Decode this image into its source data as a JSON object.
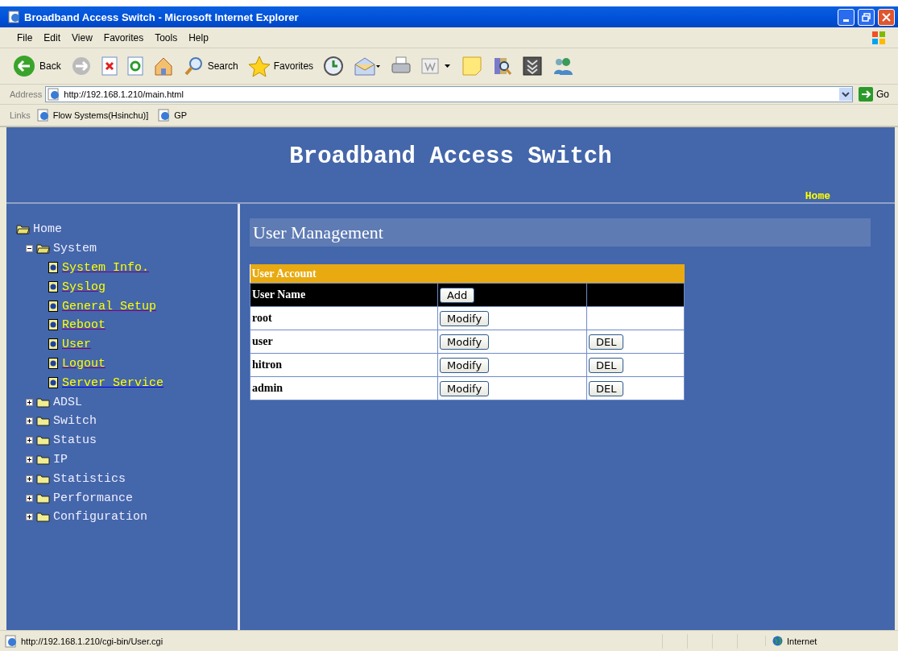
{
  "window": {
    "title": "Broadband Access Switch - Microsoft Internet Explorer"
  },
  "menu": [
    "File",
    "Edit",
    "View",
    "Favorites",
    "Tools",
    "Help"
  ],
  "toolbar": [
    {
      "kind": "back",
      "label": "Back"
    },
    {
      "kind": "forward"
    },
    {
      "kind": "stop"
    },
    {
      "kind": "refresh"
    },
    {
      "kind": "home"
    },
    {
      "kind": "search",
      "label": "Search"
    },
    {
      "kind": "favorites",
      "label": "Favorites"
    },
    {
      "kind": "history"
    },
    {
      "kind": "mail"
    },
    {
      "kind": "print"
    },
    {
      "kind": "edit"
    },
    {
      "kind": "note"
    },
    {
      "kind": "research"
    },
    {
      "kind": "download"
    },
    {
      "kind": "messenger"
    }
  ],
  "address": {
    "label": "Address",
    "value": "http://192.168.1.210/main.html",
    "go": "Go"
  },
  "links": {
    "label": "Links",
    "items": [
      "Flow Systems(Hsinchu)]",
      "GP"
    ]
  },
  "page": {
    "title": "Broadband Access Switch",
    "home_link": "Home"
  },
  "tree": {
    "label": "Home",
    "expanded": true,
    "children": [
      {
        "label": "System",
        "expanded": true,
        "children": [
          {
            "label": "System Info.",
            "kind": "page",
            "visited": true
          },
          {
            "label": "Syslog",
            "kind": "page",
            "visited": true
          },
          {
            "label": "General Setup",
            "kind": "page",
            "visited": true
          },
          {
            "label": "Reboot",
            "kind": "page",
            "visited": true
          },
          {
            "label": "User",
            "kind": "page",
            "visited": true
          },
          {
            "label": "Logout",
            "kind": "page",
            "visited": true
          },
          {
            "label": "Server Service",
            "kind": "page",
            "visited": false
          }
        ]
      },
      {
        "label": "ADSL",
        "expanded": false
      },
      {
        "label": "Switch",
        "expanded": false
      },
      {
        "label": "Status",
        "expanded": false
      },
      {
        "label": "IP",
        "expanded": false
      },
      {
        "label": "Statistics",
        "expanded": false
      },
      {
        "label": "Performance",
        "expanded": false
      },
      {
        "label": "Configuration",
        "expanded": false
      }
    ]
  },
  "content": {
    "heading": "User Management",
    "table_title": "User Account",
    "column_header": "User Name",
    "add_button": "Add",
    "rows": [
      {
        "name": "root",
        "modify": "Modify"
      },
      {
        "name": "user",
        "modify": "Modify",
        "delete": "DEL"
      },
      {
        "name": "hitron",
        "modify": "Modify",
        "delete": "DEL"
      },
      {
        "name": "admin",
        "modify": "Modify",
        "delete": "DEL"
      }
    ]
  },
  "status_bar": {
    "url": "http://192.168.1.210/cgi-bin/User.cgi",
    "zone": "Internet"
  }
}
